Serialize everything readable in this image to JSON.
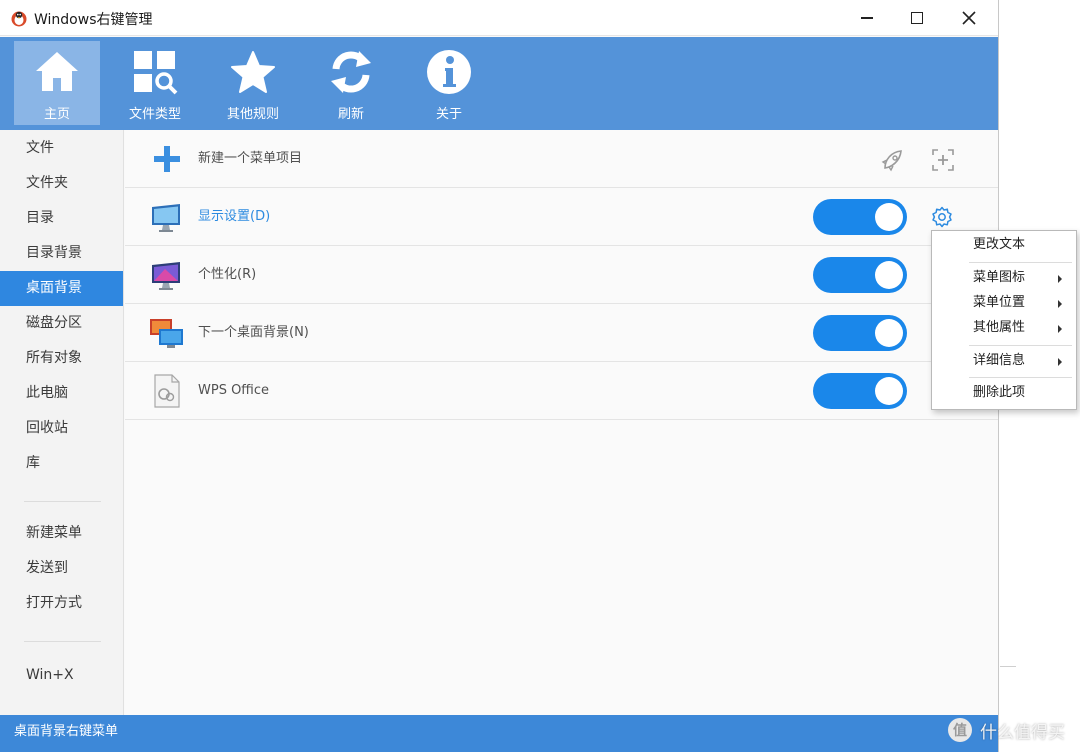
{
  "window": {
    "title": "Windows右键管理"
  },
  "toolbar": {
    "items": [
      {
        "label": "主页",
        "icon": "home-icon",
        "active": true
      },
      {
        "label": "文件类型",
        "icon": "file-types-icon",
        "active": false
      },
      {
        "label": "其他规则",
        "icon": "star-icon",
        "active": false
      },
      {
        "label": "刷新",
        "icon": "refresh-icon",
        "active": false
      },
      {
        "label": "关于",
        "icon": "info-icon",
        "active": false
      }
    ]
  },
  "sidebar": {
    "items": [
      "文件",
      "文件夹",
      "目录",
      "目录背景",
      "桌面背景",
      "磁盘分区",
      "所有对象",
      "此电脑",
      "回收站",
      "库"
    ],
    "items2": [
      "新建菜单",
      "发送到",
      "打开方式"
    ],
    "items3": [
      "Win+X"
    ],
    "selected": "桌面背景"
  },
  "main": {
    "new_item_label": "新建一个菜单项目",
    "rows": [
      {
        "label": "显示设置(D)",
        "icon": "display-settings-icon",
        "enabled": true,
        "highlighted": true
      },
      {
        "label": "个性化(R)",
        "icon": "personalize-icon",
        "enabled": true,
        "highlighted": false
      },
      {
        "label": "下一个桌面背景(N)",
        "icon": "next-background-icon",
        "enabled": true,
        "highlighted": false
      },
      {
        "label": "WPS Office",
        "icon": "wps-document-icon",
        "enabled": true,
        "highlighted": false
      }
    ]
  },
  "context_menu": {
    "items": [
      {
        "label": "更改文本",
        "submenu": false
      },
      {
        "label": "菜单图标",
        "submenu": true
      },
      {
        "label": "菜单位置",
        "submenu": true
      },
      {
        "label": "其他属性",
        "submenu": true
      },
      {
        "label": "详细信息",
        "submenu": true
      },
      {
        "label": "删除此项",
        "submenu": false
      }
    ]
  },
  "status": {
    "text": "桌面背景右键菜单"
  },
  "watermark": {
    "badge": "值",
    "text": "什么值得买"
  },
  "colors": {
    "toolbar": "#5493d9",
    "accent": "#1a87ea",
    "status_bar": "#3d88d8",
    "selected_item": "#2f87e0"
  }
}
